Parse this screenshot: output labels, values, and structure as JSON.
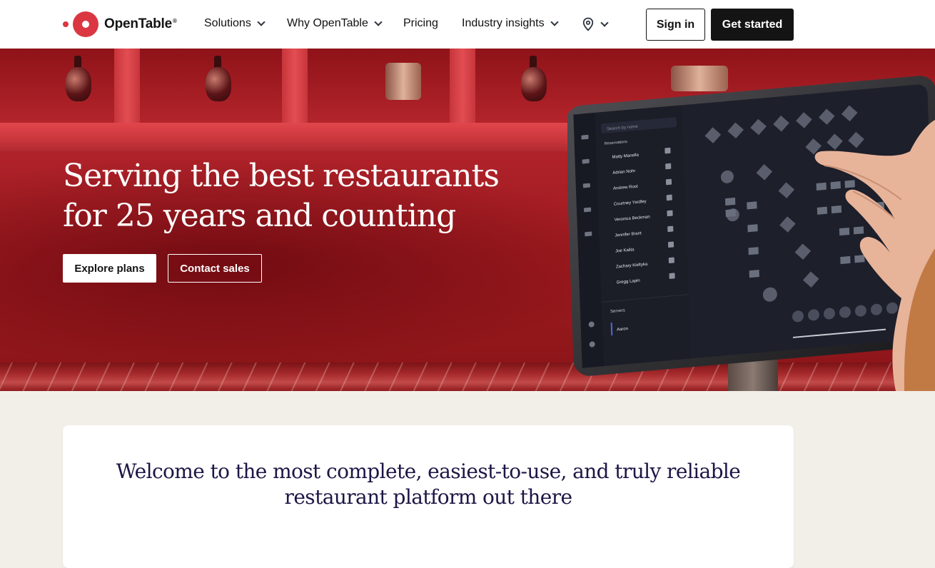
{
  "header": {
    "logo_text": "OpenTable",
    "logo_reg": "®",
    "nav": [
      {
        "label": "Solutions",
        "has_dropdown": true
      },
      {
        "label": "Why OpenTable",
        "has_dropdown": true
      },
      {
        "label": "Pricing",
        "has_dropdown": false
      },
      {
        "label": "Industry insights",
        "has_dropdown": true
      }
    ],
    "location_icon": "map-pin-icon",
    "sign_in": "Sign in",
    "get_started": "Get started"
  },
  "hero": {
    "title_line1": "Serving the best restaurants",
    "title_line2": "for 25 years and counting",
    "explore": "Explore plans",
    "contact": "Contact sales"
  },
  "welcome": {
    "line1": "Welcome to the most complete, easiest-to-use, and truly reliable",
    "line2": "restaurant platform out there"
  },
  "tablet": {
    "search_placeholder": "Search by name",
    "reservations_label": "Reservations",
    "servers_label": "Servers",
    "server_name": "Aaron",
    "guests": [
      "Matty Manella",
      "Adrian Nohr",
      "Andrew Root",
      "Courtney Yardley",
      "Veronica Beckman",
      "Jennifer Brant",
      "Joe Kalita",
      "Zachary Kieltyka",
      "Gregg Lapin"
    ]
  },
  "colors": {
    "brand_red": "#da3743",
    "dark": "#141414",
    "headline_navy": "#1c1646",
    "page_bg": "#f2efe8"
  }
}
